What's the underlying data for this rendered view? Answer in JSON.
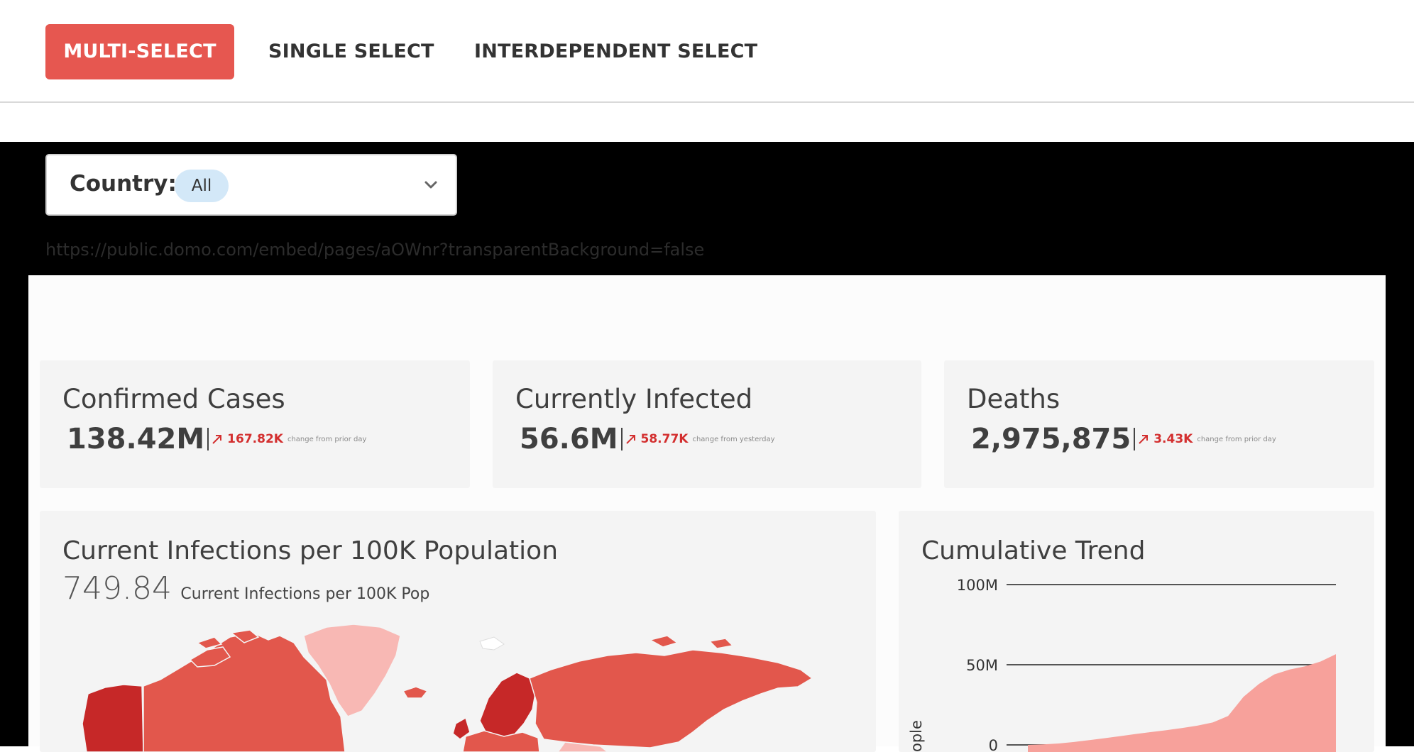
{
  "tabs": [
    {
      "label": "MULTI-SELECT",
      "active": true
    },
    {
      "label": "SINGLE SELECT",
      "active": false
    },
    {
      "label": "INTERDEPENDENT SELECT",
      "active": false
    }
  ],
  "filter": {
    "label": "Country:",
    "selected": "All",
    "icon": "chevron-down-icon"
  },
  "embed_url": "https://public.domo.com/embed/pages/aOWnr?transparentBackground=false",
  "kpis": [
    {
      "title": "Confirmed Cases",
      "value": "138.42M",
      "change": "167.82K",
      "note": "change from prior day"
    },
    {
      "title": "Currently Infected",
      "value": "56.6M",
      "change": "58.77K",
      "note": "change from yesterday"
    },
    {
      "title": "Deaths",
      "value": "2,975,875",
      "change": "3.43K",
      "note": "change from prior day"
    }
  ],
  "map_card": {
    "title": "Current Infections per 100K Population",
    "value": "749.84",
    "caption": "Current Infections per 100K Pop"
  },
  "trend_card": {
    "title": "Cumulative Trend",
    "ylabel_partial": "ople"
  },
  "colors": {
    "accent": "#e65750",
    "change_red": "#d32f2f",
    "map_dark": "#c62828",
    "map_mid": "#e2574c",
    "map_light": "#f8b8b4",
    "trend_fill": "#f7a19b"
  },
  "chart_data": {
    "type": "area",
    "title": "Cumulative Trend",
    "yticks": [
      "100M",
      "50M",
      "0"
    ],
    "ylim": [
      0,
      100000000
    ],
    "grid": true,
    "x": [
      0,
      1,
      2,
      3,
      4,
      5,
      6,
      7,
      8,
      9,
      10,
      11,
      12,
      13,
      14,
      15,
      16,
      17,
      18,
      19,
      20
    ],
    "values": [
      0,
      300000,
      900000,
      1800000,
      3000000,
      4200000,
      5500000,
      6800000,
      8000000,
      9200000,
      10500000,
      12000000,
      14000000,
      18000000,
      30000000,
      38000000,
      44000000,
      47000000,
      49000000,
      52000000,
      56600000
    ]
  }
}
